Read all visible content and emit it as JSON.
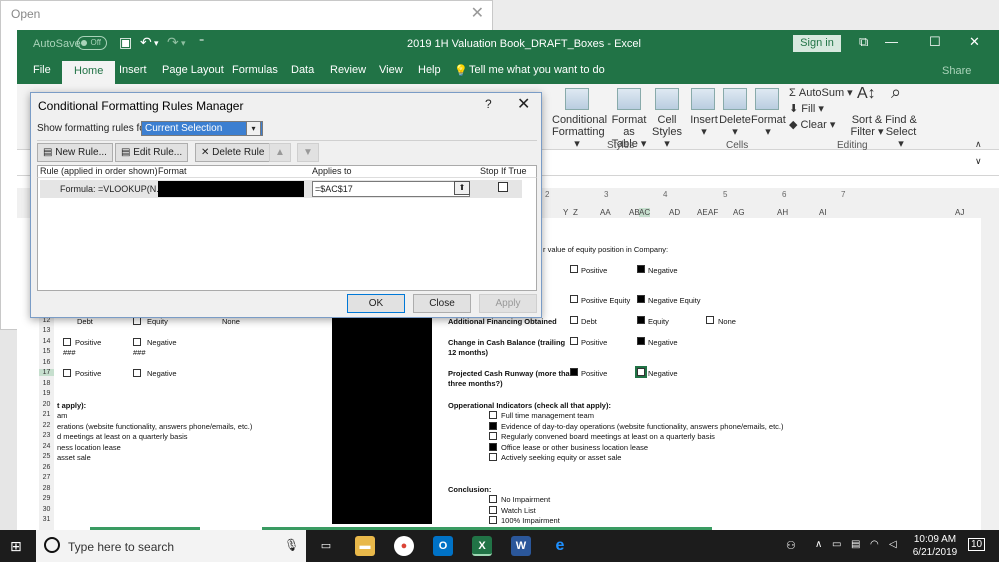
{
  "open_dialog": {
    "title": "Open"
  },
  "excel": {
    "autosave_label": "AutoSave",
    "autosave_state": "Off",
    "document_title": "2019 1H Valuation Book_DRAFT_Boxes  -  Excel",
    "sign_in": "Sign in",
    "tabs": [
      "File",
      "Home",
      "Insert",
      "Page Layout",
      "Formulas",
      "Data",
      "Review",
      "View",
      "Help"
    ],
    "active_tab": "Home",
    "tell_me": "Tell me what you want to do",
    "share": "Share",
    "ribbon": {
      "styles_buttons": [
        {
          "line1": "Conditional",
          "line2": "Formatting ▾"
        },
        {
          "line1": "Format as",
          "line2": "Table ▾"
        },
        {
          "line1": "Cell",
          "line2": "Styles ▾"
        }
      ],
      "cells_buttons": [
        "Insert",
        "Delete",
        "Format"
      ],
      "cells_arrows": [
        "▾",
        "▾",
        "▾"
      ],
      "editing": {
        "autosum": "AutoSum",
        "fill": "Fill",
        "clear": "Clear",
        "sort_filter_1": "Sort &",
        "sort_filter_2": "Filter ▾",
        "find_select_1": "Find &",
        "find_select_2": "Select ▾"
      },
      "groups": [
        "Styles",
        "Cells",
        "Editing"
      ]
    },
    "column_numbers": [
      "2",
      "3",
      "4",
      "5",
      "6",
      "7"
    ],
    "column_letters": [
      "Y",
      "Z",
      "AA",
      "AB",
      "AC",
      "AD",
      "AE",
      "AF",
      "AG",
      "AH",
      "AI",
      "AJ"
    ],
    "row_numbers": [
      "12",
      "13",
      "14",
      "15",
      "16",
      "17",
      "18",
      "19",
      "20",
      "21",
      "22",
      "23",
      "24",
      "25",
      "26",
      "27",
      "28",
      "29",
      "30",
      "31"
    ],
    "left_cells": {
      "r12a": "Debt",
      "r12b": "Equity",
      "r12c": "None",
      "r14a": "Positive",
      "r14b": "Negative",
      "r15a": "###",
      "r15b": "###",
      "r17a": "Positive",
      "r17b": "Negative",
      "r20": "t apply):",
      "r21": "am",
      "r22": "erations (website functionality, answers phone/emails, etc.)",
      "r23": "d meetings at least on a quarterly basis",
      "r24": "ness location lease",
      "r25": "asset sale"
    },
    "right_cells": {
      "top_text": "r value of equity position in Company:",
      "positive": "Positive",
      "negative": "Negative",
      "positive_equity": "Positive Equity",
      "negative_equity": "Negative Equity",
      "additional_financing": "Additional Financing Obtained",
      "debt": "Debt",
      "equity": "Equity",
      "none": "None",
      "change_cash_1": "Change in Cash Balance (trailing",
      "change_cash_2": "12 months)",
      "runway_1": "Projected Cash Runway (more than",
      "runway_2": "three months?)",
      "op_indicators": "Opperational Indicators (check all that apply):",
      "op_items": [
        "Full time management team",
        "Evidence of day-to-day operations (website functionality, answers phone/emails, etc.)",
        "Regularly convened board meetings at least on a quarterly basis",
        "Office lease or other business location lease",
        "Actively seeking equity or asset sale"
      ],
      "conclusion": "Conclusion:",
      "conclusion_items": [
        "No Impairment",
        "Watch List",
        "100% Impairment"
      ]
    }
  },
  "dialog": {
    "title": "Conditional Formatting Rules Manager",
    "help": "?",
    "show_label": "Show formatting rules for:",
    "show_value": "Current Selection",
    "new_rule": "New Rule...",
    "edit_rule": "Edit Rule...",
    "delete_rule": "Delete Rule",
    "headers": {
      "rule": "Rule (applied in order shown)",
      "format": "Format",
      "applies": "Applies to",
      "stop": "Stop If True"
    },
    "rules": [
      {
        "rule": "Formula: =VLOOKUP(N...",
        "applies_to": "=$AC$17"
      }
    ],
    "ok": "OK",
    "close": "Close",
    "apply": "Apply"
  },
  "taskbar": {
    "search_placeholder": "Type here to search",
    "time": "10:09 AM",
    "date": "6/21/2019",
    "notifications": "10"
  }
}
